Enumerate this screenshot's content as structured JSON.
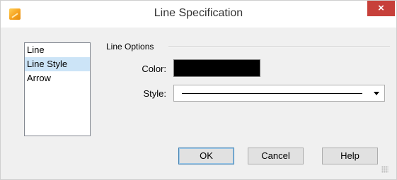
{
  "window": {
    "title": "Line Specification",
    "close_label": "×",
    "app_icon": "app-icon"
  },
  "sidebar": {
    "items": [
      {
        "label": "Line",
        "selected": false
      },
      {
        "label": "Line Style",
        "selected": true
      },
      {
        "label": "Arrow",
        "selected": false
      }
    ]
  },
  "line_options": {
    "group_label": "Line Options",
    "color_label": "Color:",
    "color_value": "#000000",
    "style_label": "Style:",
    "style_value_icon": "solid-line"
  },
  "buttons": {
    "ok": "OK",
    "cancel": "Cancel",
    "help": "Help"
  },
  "colors": {
    "selection": "#cce4f7",
    "close": "#c7403a"
  }
}
